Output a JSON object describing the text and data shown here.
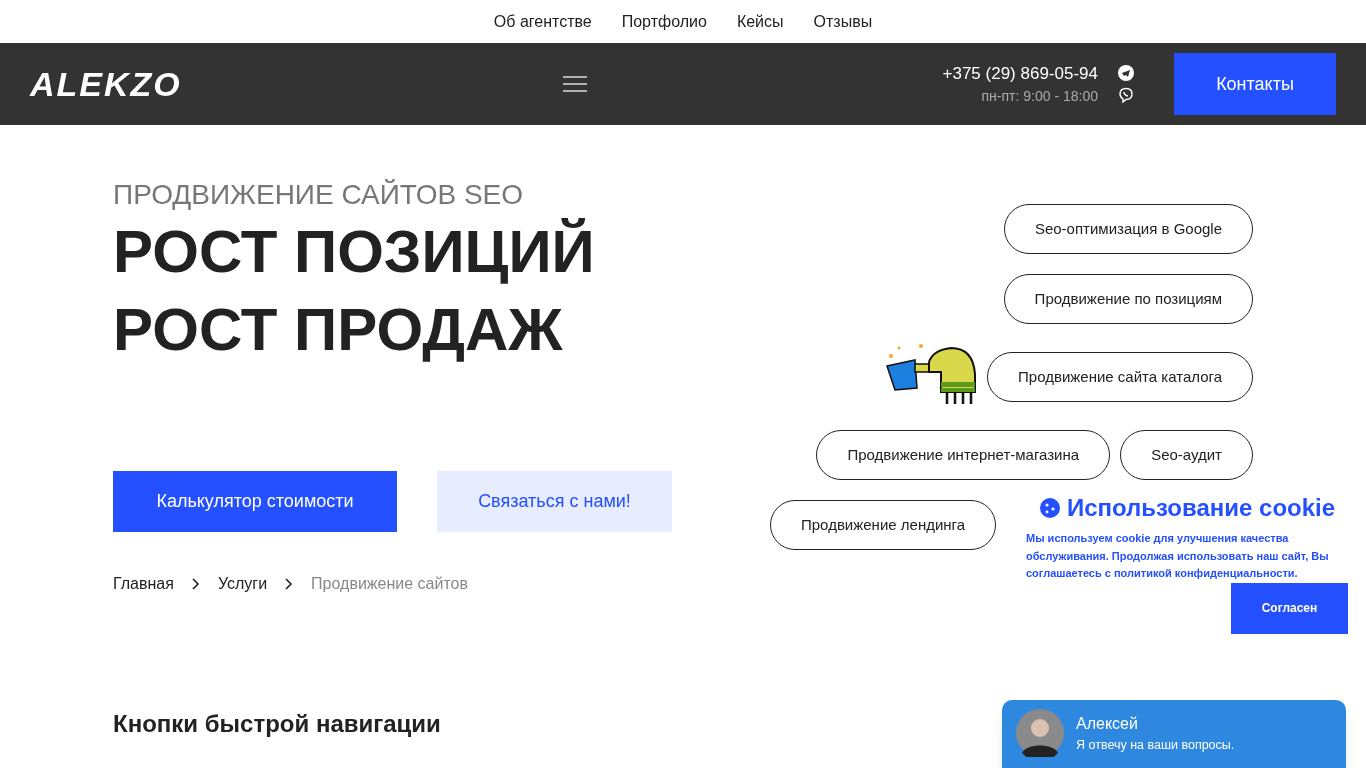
{
  "top_nav": [
    "Об агентстве",
    "Портфолио",
    "Кейсы",
    "Отзывы"
  ],
  "header": {
    "logo": "ALEKZO",
    "phone": "+375 (29) 869-05-94",
    "hours": "пн-пт: 9:00 - 18:00",
    "contacts_button": "Контакты"
  },
  "hero": {
    "eyebrow": "ПРОДВИЖЕНИЕ САЙТОВ SEO",
    "title_lines": [
      "РОСТ ПОЗИЦИЙ",
      "РОСТ ПРОДАЖ"
    ],
    "primary_button": "Калькулятор стоимости",
    "secondary_button": "Связаться с нами!"
  },
  "breadcrumbs": [
    {
      "label": "Главная",
      "current": false
    },
    {
      "label": "Услуги",
      "current": false
    },
    {
      "label": "Продвижение сайтов",
      "current": true
    }
  ],
  "service_rows": [
    [
      "Seo-оптимизация в Google"
    ],
    [
      "Продвижение по позициям"
    ],
    [
      "Продвижение сайта каталога"
    ],
    [
      "Продвижение интернет-магазина",
      "Seo-аудит"
    ],
    [
      "Продвижение лендинга"
    ]
  ],
  "quick_nav": {
    "title": "Кнопки быстрой навигации"
  },
  "cookie": {
    "title": "Использование cookie",
    "text": "Мы используем cookie для улучшения качества обслуживания. Продолжая использовать наш сайт, Вы соглашаетесь с политикой конфиденциальности.",
    "button": "Согласен"
  },
  "chat": {
    "name": "Алексей",
    "message": "Я отвечу на ваши вопросы."
  }
}
